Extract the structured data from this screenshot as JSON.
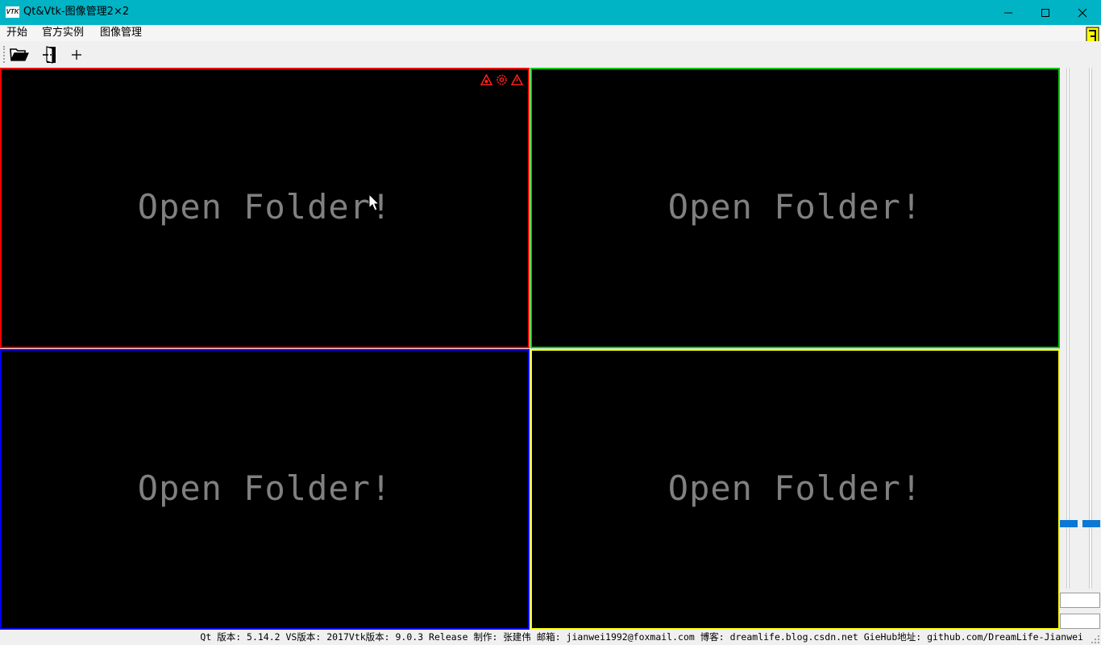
{
  "window": {
    "title": "Qt&Vtk-图像管理2×2",
    "app_icon_text": "VTK",
    "title_bar_color": "#00b4c6"
  },
  "menu": {
    "items": [
      "开始",
      "官方实例",
      "图像管理"
    ]
  },
  "toolbar": {
    "buttons": [
      {
        "name": "open-folder",
        "icon": "folder-open-icon"
      },
      {
        "name": "exit",
        "icon": "exit-door-icon"
      },
      {
        "name": "add",
        "icon": "plus-icon"
      }
    ]
  },
  "viewports": [
    {
      "position": "top-left",
      "text": "Open Folder!",
      "border_color": "#ff0000",
      "active": true
    },
    {
      "position": "top-right",
      "text": "Open Folder!",
      "border_color": "#00cc00",
      "active": false
    },
    {
      "position": "bottom-left",
      "text": "Open Folder!",
      "border_color": "#0000ff",
      "active": false
    },
    {
      "position": "bottom-right",
      "text": "Open Folder!",
      "border_color": "#ffff00",
      "active": false
    }
  ],
  "viewport_icons": [
    "triangle-icon",
    "gear-icon",
    "warning-icon"
  ],
  "sliders": [
    {
      "name": "slider-left",
      "value_fraction": 0.12
    },
    {
      "name": "slider-right",
      "value_fraction": 0.12
    }
  ],
  "status": {
    "text": "Qt 版本: 5.14.2  VS版本: 2017Vtk版本: 9.0.3 Release 制作: 张建伟 邮箱: jianwei1992@foxmail.com 博客: dreamlife.blog.csdn.net GieHub地址: github.com/DreamLife-Jianwei"
  },
  "colors": {
    "accent": "#0a78d4",
    "corner_icon": "#ffff00"
  }
}
